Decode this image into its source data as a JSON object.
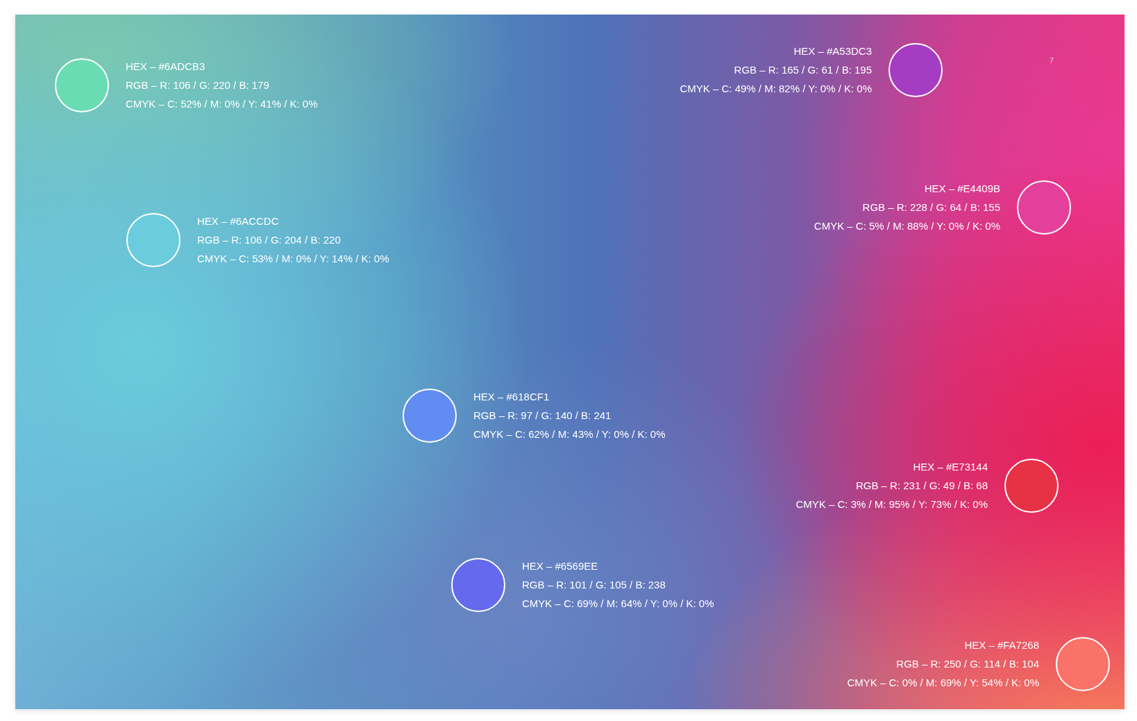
{
  "page_number": "7",
  "swatches": [
    {
      "color": "#6adcb3",
      "hex": "HEX – #6ADCB3",
      "rgb": "RGB – R: 106 / G: 220 / B: 179",
      "cmyk": "CMYK – C: 52% / M: 0% / Y: 41% / K: 0%"
    },
    {
      "color": "#a53dc3",
      "hex": "HEX – #A53DC3",
      "rgb": "RGB – R: 165 / G: 61 / B: 195",
      "cmyk": "CMYK – C: 49% / M: 82% / Y: 0% / K: 0%"
    },
    {
      "color": "#e4409b",
      "hex": "HEX – #E4409B",
      "rgb": "RGB – R: 228 / G: 64 / B: 155",
      "cmyk": "CMYK – C: 5% / M: 88% / Y: 0% / K: 0%"
    },
    {
      "color": "#6accdc",
      "hex": "HEX – #6ACCDC",
      "rgb": "RGB – R: 106 / G: 204 / B: 220",
      "cmyk": "CMYK – C: 53% / M: 0% / Y: 14% / K: 0%"
    },
    {
      "color": "#618cf1",
      "hex": "HEX – #618CF1",
      "rgb": "RGB – R: 97 / G: 140 / B: 241",
      "cmyk": "CMYK – C: 62% / M: 43% / Y: 0% / K: 0%"
    },
    {
      "color": "#e73144",
      "hex": "HEX – #E73144",
      "rgb": "RGB – R: 231 / G: 49 / B: 68",
      "cmyk": "CMYK – C: 3% / M: 95% / Y: 73% / K: 0%"
    },
    {
      "color": "#6569ee",
      "hex": "HEX – #6569EE",
      "rgb": "RGB – R: 101 / G: 105 / B: 238",
      "cmyk": "CMYK – C: 69% / M: 64% / Y: 0% / K: 0%"
    },
    {
      "color": "#fa7268",
      "hex": "HEX – #FA7268",
      "rgb": "RGB – R: 250 / G: 114 / B: 104",
      "cmyk": "CMYK – C: 0% / M: 69% / Y: 54% / K: 0%"
    }
  ]
}
